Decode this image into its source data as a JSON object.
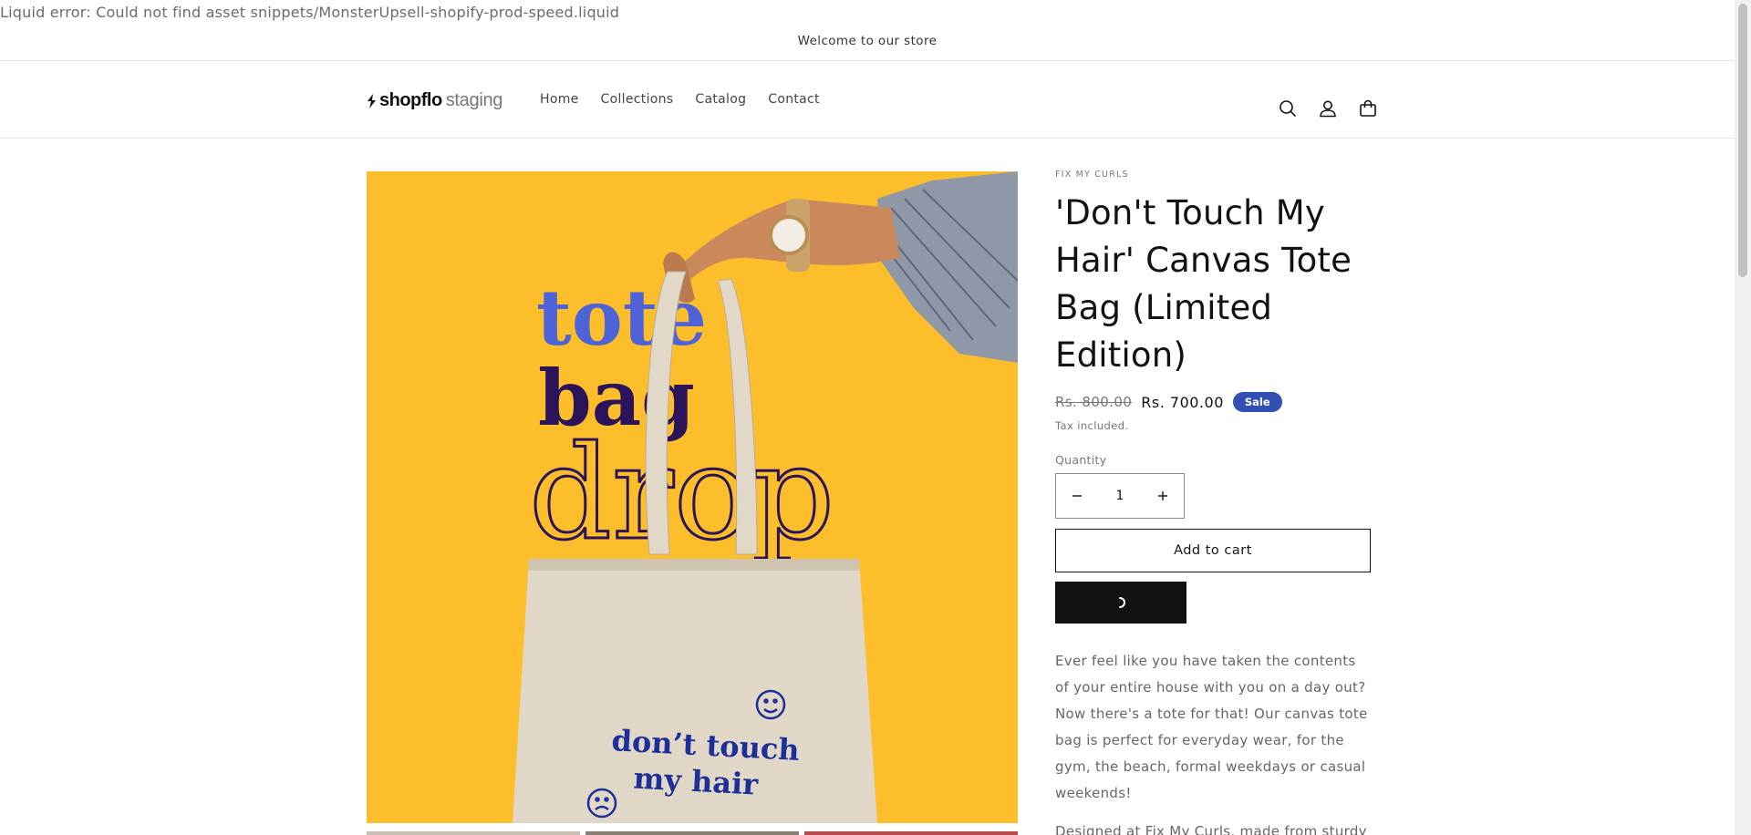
{
  "error_text": "Liquid error: Could not find asset snippets/MonsterUpsell-shopify-prod-speed.liquid",
  "announcement": "Welcome to our store",
  "header": {
    "logo_brand": "shopflo",
    "logo_env": "staging",
    "nav": [
      "Home",
      "Collections",
      "Catalog",
      "Contact"
    ],
    "icons": [
      "search-icon",
      "account-icon",
      "cart-icon"
    ]
  },
  "media": {
    "headline": [
      "tote",
      "bag",
      "drop"
    ],
    "bag_text": [
      "don’t touch",
      "my hair"
    ],
    "colors": {
      "background": "#fdbe2c",
      "blue": "#4f63d8",
      "purple": "#2b145a",
      "navy": "#1e2f9a"
    }
  },
  "product": {
    "vendor": "FIX MY CURLS",
    "title": "'Don't Touch My Hair' Canvas Tote Bag (Limited Edition)",
    "compare_price": "Rs. 800.00",
    "sale_price": "Rs. 700.00",
    "badge": "Sale",
    "tax_note": "Tax included.",
    "quantity_label": "Quantity",
    "quantity": "1",
    "add_to_cart": "Add to cart",
    "description": [
      "Ever feel like you have taken the contents of your entire house with you on a day out? Now there's a tote for that! Our canvas tote bag is perfect for everyday wear, for the gym, the beach, formal weekdays or casual weekends!",
      "Designed at Fix My Curls, made from sturdy natural canvas stitched in India!"
    ]
  },
  "colors": {
    "accent": "#334fb4",
    "text": "#121212",
    "muted": "#777777"
  }
}
